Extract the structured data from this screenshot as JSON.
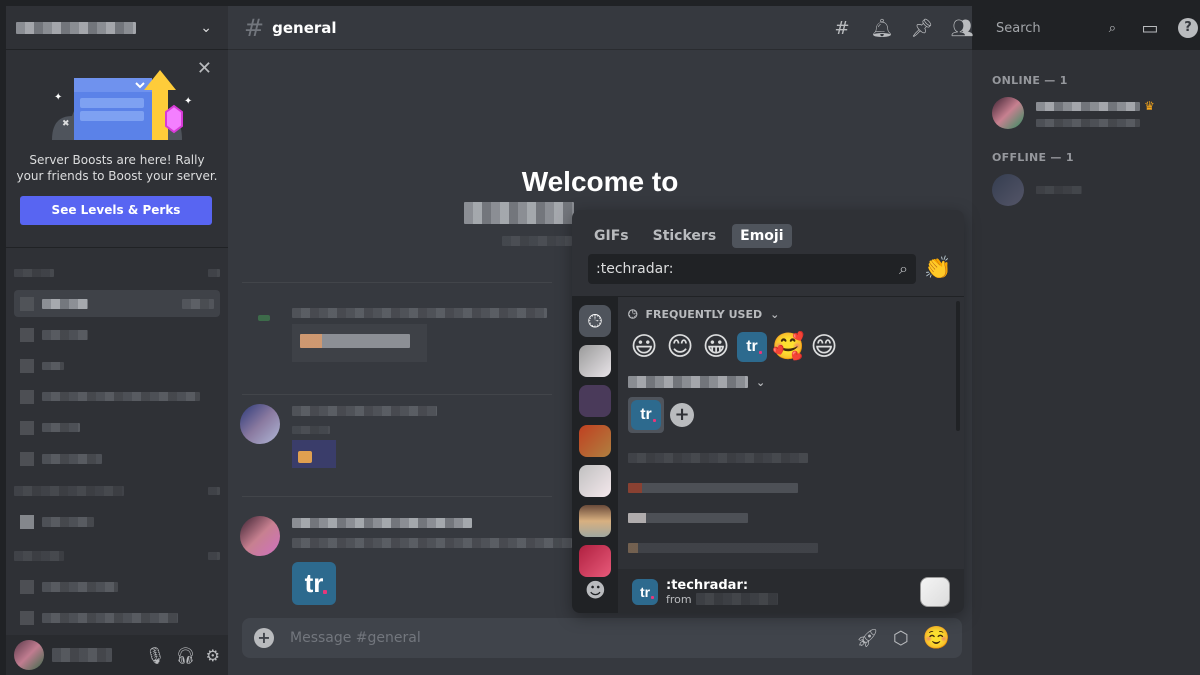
{
  "server": {
    "name_redacted": true,
    "dropdown_icon": "chevron-down-icon"
  },
  "boost_banner": {
    "text": "Server Boosts are here! Rally your friends to Boost your server.",
    "button_label": "See Levels & Perks",
    "close_icon": "close-icon"
  },
  "channel": {
    "name": "general",
    "hash_icon": "hash-icon"
  },
  "header": {
    "icons": [
      "threads-icon",
      "bell-icon",
      "pin-icon",
      "members-icon"
    ],
    "search_placeholder": "Search",
    "right_icons": [
      "inbox-icon",
      "help-icon"
    ]
  },
  "welcome": {
    "title": "Welcome to",
    "server_name_redacted": true
  },
  "composer": {
    "placeholder": "Message #general",
    "icons": [
      "gift-rocket-icon",
      "nitro-icon",
      "emoji-button-icon"
    ]
  },
  "user_panel": {
    "icons": [
      "microphone-icon",
      "headphones-icon",
      "settings-icon"
    ]
  },
  "members": {
    "online_label": "ONLINE — 1",
    "offline_label": "OFFLINE — 1",
    "owner_icon": "crown-icon"
  },
  "picker": {
    "tabs": [
      "GIFs",
      "Stickers",
      "Emoji"
    ],
    "active_tab": "Emoji",
    "search_value": ":techradar:",
    "frequently_used_label": "FREQUENTLY USED",
    "frequent_emojis": [
      "😃",
      "😊",
      "😀",
      "tr",
      "🥰",
      "😄"
    ],
    "server_emoji_label": "tr",
    "preview": {
      "name": ":techradar:",
      "from_label": "from"
    }
  },
  "colors": {
    "accent": "#5865f2",
    "brand_tr": "#2d6a8e",
    "crown": "#faa81a"
  }
}
